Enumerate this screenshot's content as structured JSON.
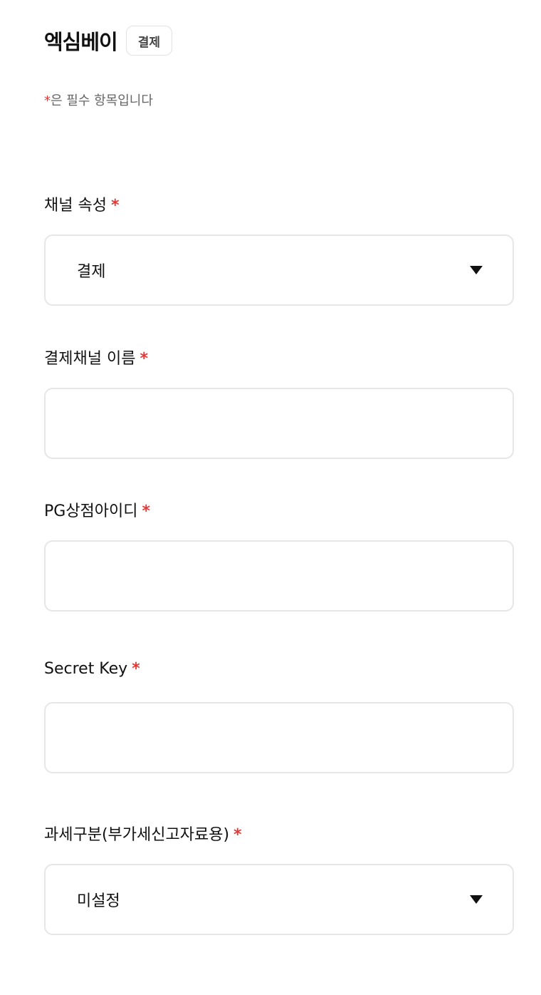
{
  "header": {
    "title": "엑심베이",
    "badge": "결제"
  },
  "required_note": {
    "star": "*",
    "text": "은 필수 항목입니다"
  },
  "fields": [
    {
      "label": "채널 속성",
      "star": "*",
      "type": "select",
      "value": "결제"
    },
    {
      "label": "결제채널 이름",
      "star": "*",
      "type": "text",
      "value": ""
    },
    {
      "label": "PG상점아이디",
      "star": "*",
      "type": "text",
      "value": ""
    },
    {
      "label": "Secret Key",
      "star": "*",
      "type": "text",
      "value": ""
    },
    {
      "label": "과세구분(부가세신고자료용)",
      "star": "*",
      "type": "select",
      "value": "미설정"
    }
  ]
}
